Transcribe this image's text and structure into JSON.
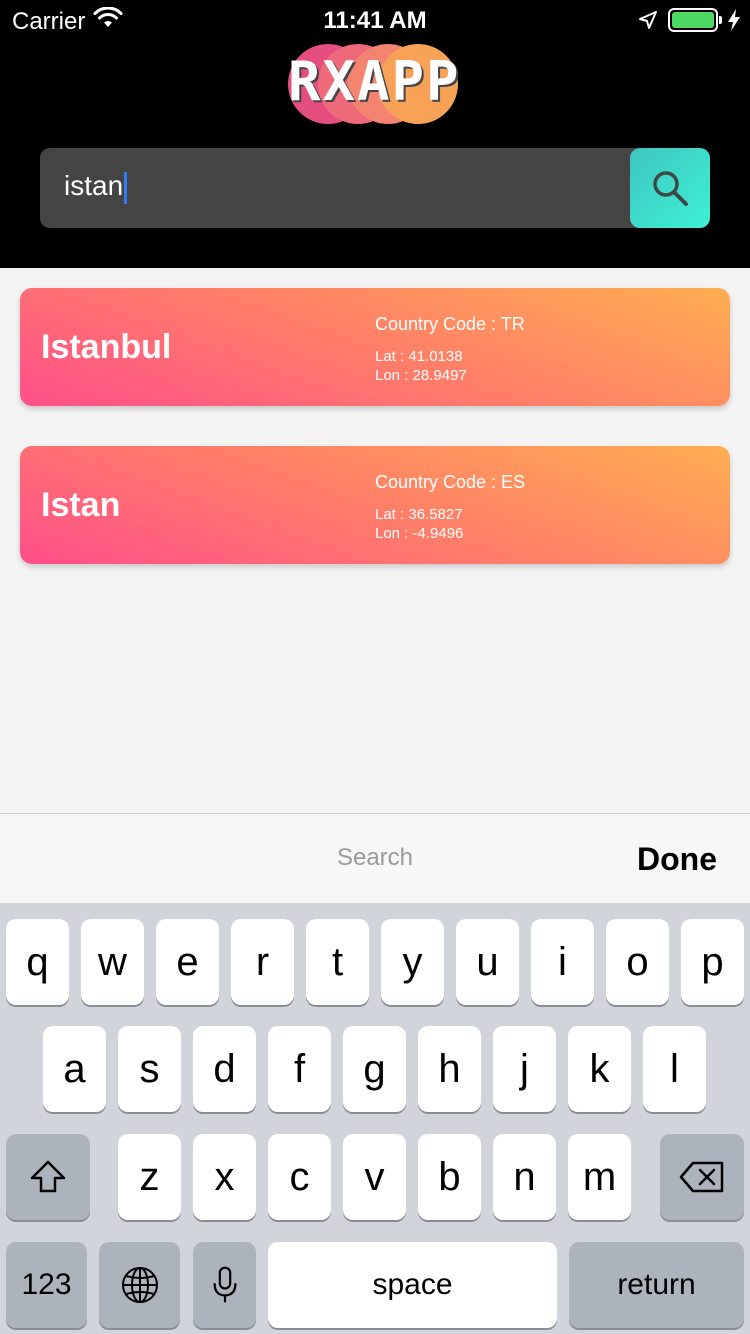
{
  "status_bar": {
    "carrier": "Carrier",
    "time": "11:41 AM"
  },
  "header": {
    "logo": "RXAPP"
  },
  "search": {
    "query": "istan",
    "icon": "search-icon"
  },
  "results": [
    {
      "city": "Istanbul",
      "country": "Country Code : TR",
      "lat": "Lat : 41.0138",
      "lon": "Lon : 28.9497"
    },
    {
      "city": "Istan",
      "country": "Country Code : ES",
      "lat": "Lat : 36.5827",
      "lon": "Lon : -4.9496"
    }
  ],
  "accessory": {
    "search_label": "Search",
    "done_label": "Done"
  },
  "keyboard": {
    "row1": [
      "q",
      "w",
      "e",
      "r",
      "t",
      "y",
      "u",
      "i",
      "o",
      "p"
    ],
    "row2": [
      "a",
      "s",
      "d",
      "f",
      "g",
      "h",
      "j",
      "k",
      "l"
    ],
    "row3": [
      "z",
      "x",
      "c",
      "v",
      "b",
      "n",
      "m"
    ],
    "numbers_label": "123",
    "space_label": "space",
    "return_label": "return"
  },
  "colors": {
    "card_start": "#ff4f8b",
    "card_end": "#ffae52",
    "search_button": "#3ed9cc",
    "battery": "#4cd964"
  }
}
